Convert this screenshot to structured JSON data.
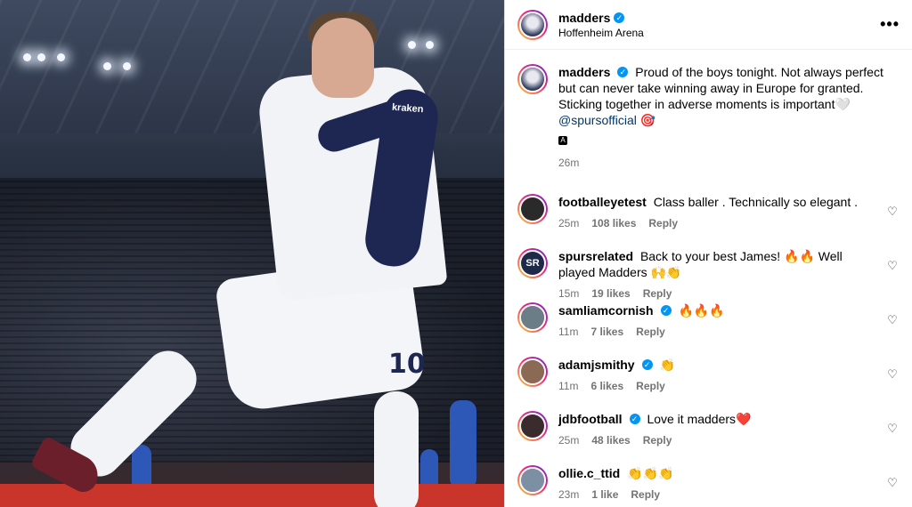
{
  "header": {
    "username": "madders",
    "location": "Hoffenheim Arena",
    "more_label": "•••"
  },
  "caption": {
    "username": "madders",
    "text": "Proud of the boys tonight. Not always perfect but can never take winning away in Europe for granted. Sticking together in adverse moments is important🤍",
    "mention": "@spursofficial",
    "trailing": "🎯",
    "badge": "A",
    "time": "26m"
  },
  "photo": {
    "shirt_sponsor": "kraken",
    "shirt_number": "10"
  },
  "comments": [
    {
      "username": "footballeyetest",
      "verified": false,
      "text": "Class baller . Technically so elegant .",
      "time": "25m",
      "likes": "108 likes",
      "reply": "Reply",
      "avatar_color": "#2a2a2a"
    },
    {
      "username": "spursrelated",
      "verified": false,
      "text": "Back to your best James! 🔥🔥 Well played Madders 🙌👏",
      "time": "15m",
      "likes": "19 likes",
      "reply": "Reply",
      "avatar_color": "#1e2a4a",
      "avatar_text": "SR"
    },
    {
      "username": "samliamcornish",
      "verified": true,
      "text": "🔥🔥🔥",
      "time": "11m",
      "likes": "7 likes",
      "reply": "Reply",
      "avatar_color": "#6b7d86"
    },
    {
      "username": "adamjsmithy",
      "verified": true,
      "text": "👏",
      "time": "11m",
      "likes": "6 likes",
      "reply": "Reply",
      "avatar_color": "#8a6a55"
    },
    {
      "username": "jdbfootball",
      "verified": true,
      "text": "Love it madders❤️",
      "time": "25m",
      "likes": "48 likes",
      "reply": "Reply",
      "avatar_color": "#3a2c2c"
    },
    {
      "username": "ollie.c_ttid",
      "verified": false,
      "text": "👏👏👏",
      "time": "23m",
      "likes": "1 like",
      "reply": "Reply",
      "avatar_color": "#7d8fa3"
    }
  ],
  "colors": {
    "verified": "#0095f6",
    "mention": "#00376b",
    "muted": "#737373"
  }
}
